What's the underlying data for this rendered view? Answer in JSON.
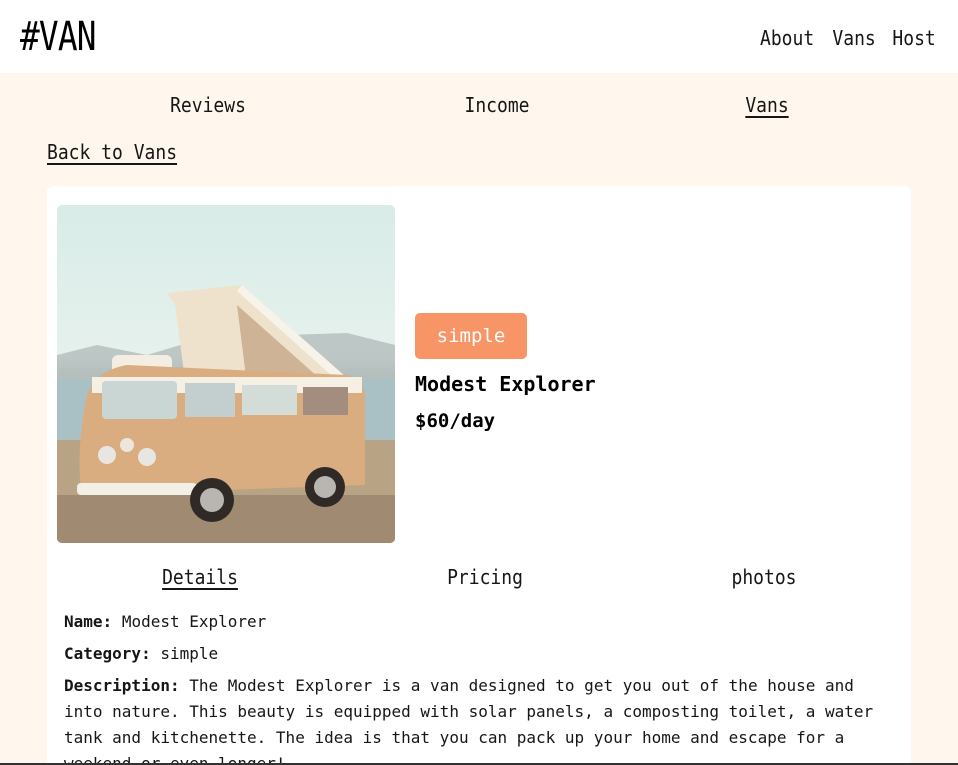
{
  "header": {
    "logo": "#VAN",
    "nav": [
      {
        "label": "About"
      },
      {
        "label": "Vans"
      },
      {
        "label": "Host"
      }
    ]
  },
  "host_nav": [
    {
      "label": "Reviews",
      "active": false
    },
    {
      "label": "Income",
      "active": false
    },
    {
      "label": "Vans",
      "active": true
    }
  ],
  "back_link": "Back to Vans",
  "van": {
    "image_alt": "Beige Volkswagen camper van with pop-up roof by the sea",
    "type_badge": "simple",
    "name": "Modest Explorer",
    "price": "$60/day",
    "badge_color": "#f79566"
  },
  "sub_tabs": [
    {
      "label": "Details",
      "active": true
    },
    {
      "label": "Pricing",
      "active": false
    },
    {
      "label": "photos",
      "active": false
    }
  ],
  "details": {
    "name_label": "Name:",
    "name_value": "Modest Explorer",
    "category_label": "Category:",
    "category_value": "simple",
    "description_label": "Description:",
    "description_value": "The Modest Explorer is a van designed to get you out of the house and into nature. This beauty is equipped with solar panels, a composting toilet, a water tank and kitchenette. The idea is that you can pack up your home and escape for a weekend or even longer!"
  }
}
